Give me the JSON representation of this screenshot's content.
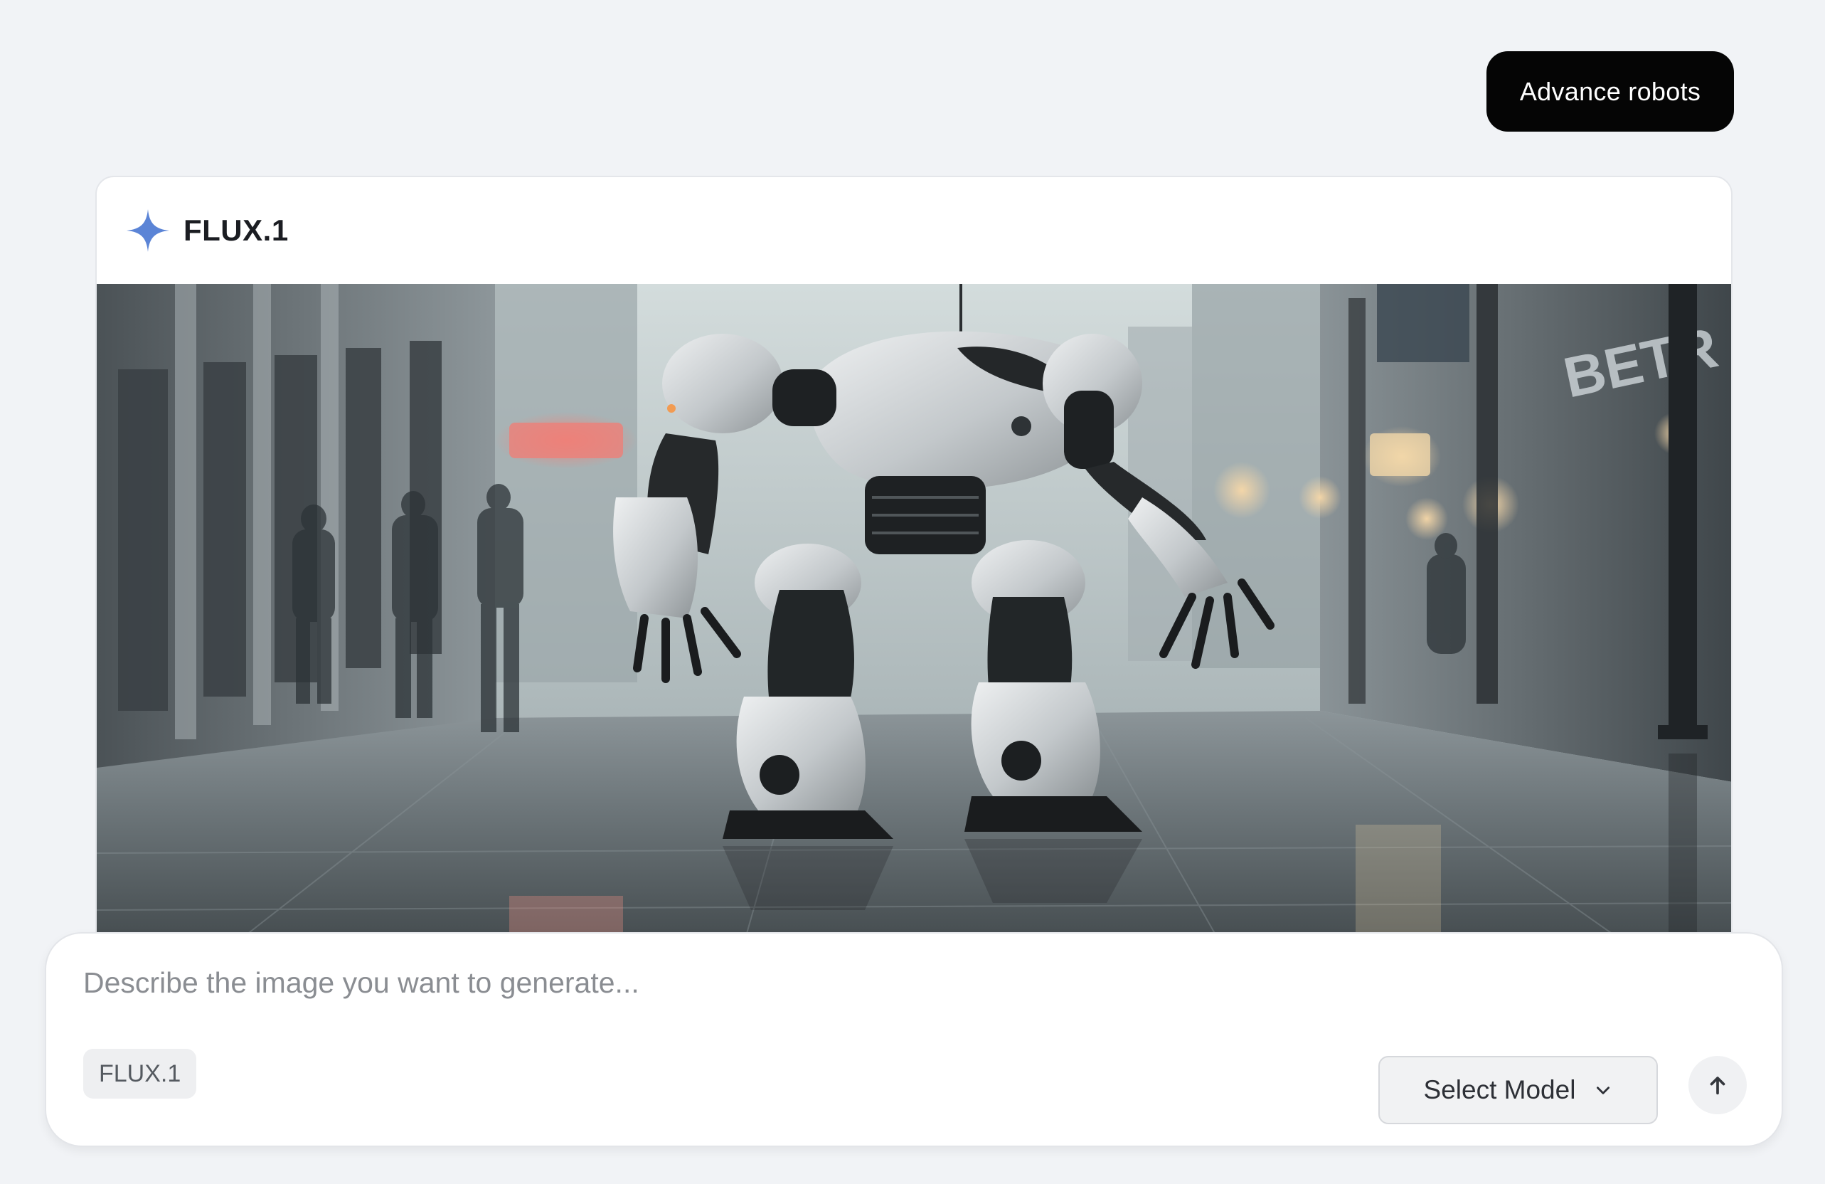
{
  "chat": {
    "user_message": "Advance robots",
    "response": {
      "model_name": "FLUX.1",
      "image_subject": "robot-in-city-street",
      "image_signs": [
        "BETR ON"
      ]
    }
  },
  "composer": {
    "placeholder": "Describe the image you want to generate...",
    "model_chip": "FLUX.1",
    "select_model_label": "Select Model"
  },
  "colors": {
    "background": "#f1f3f6",
    "user_bubble": "#050505",
    "sparkle": "#5b84d6",
    "card": "#ffffff"
  }
}
